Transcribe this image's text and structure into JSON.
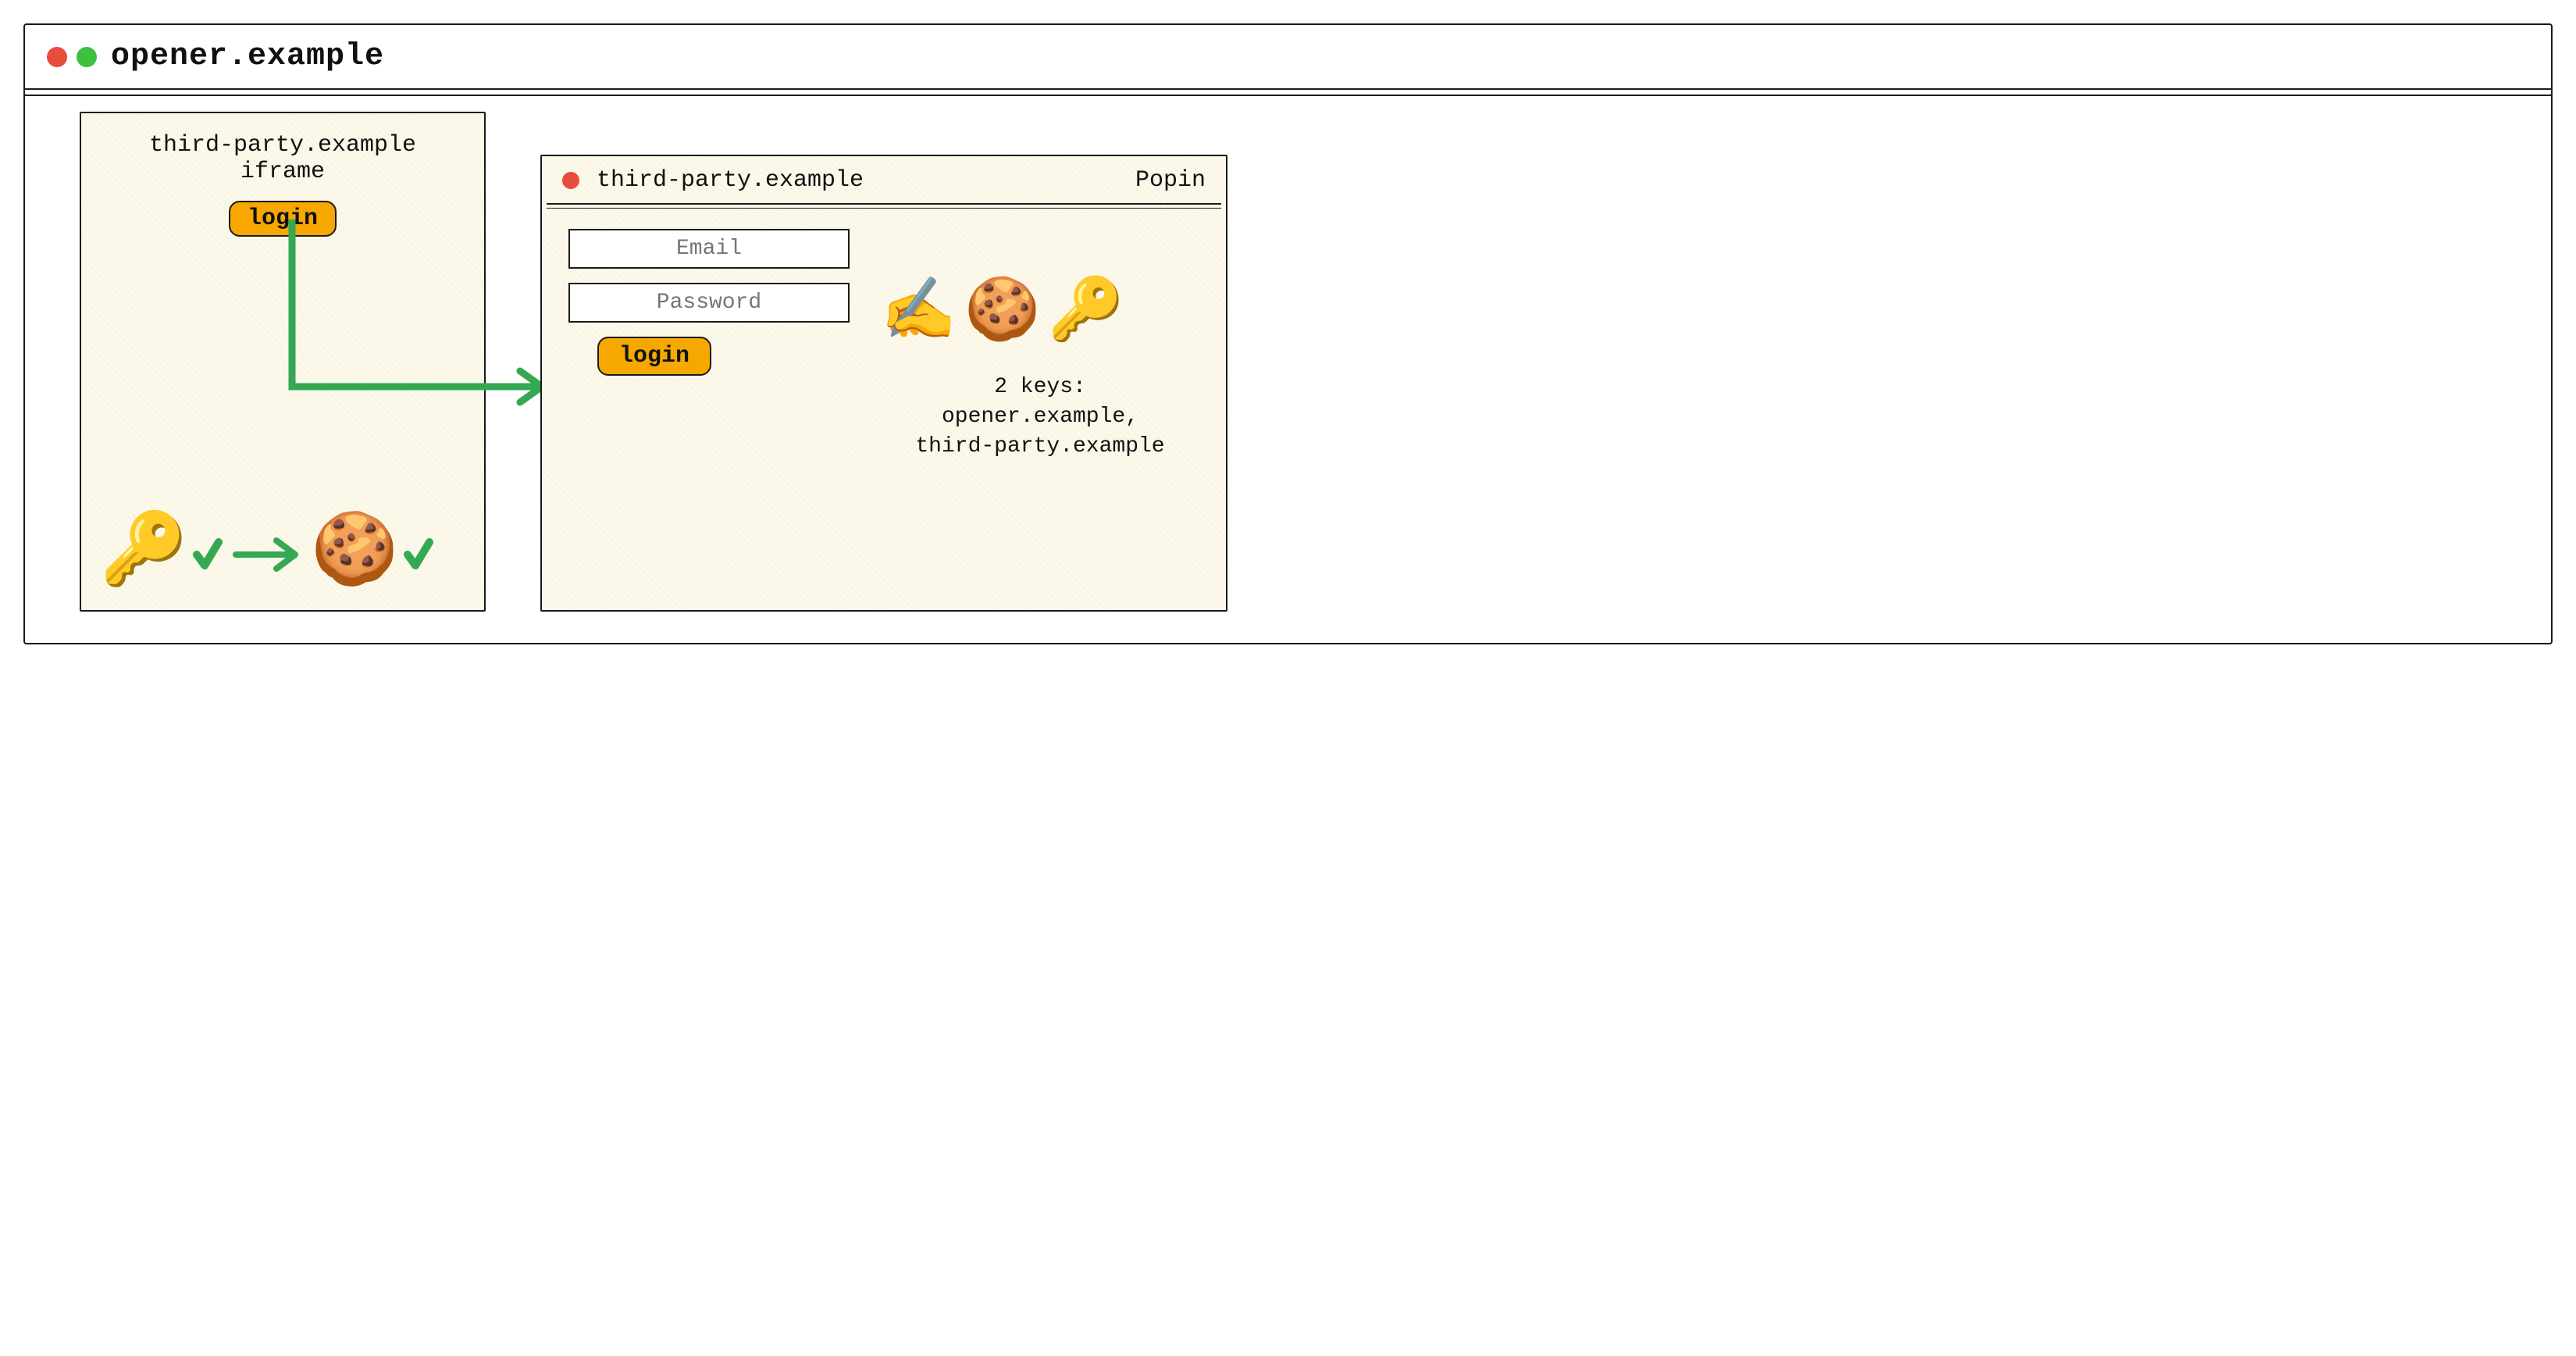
{
  "main_window": {
    "title": "opener.example"
  },
  "iframe_panel": {
    "label": "third-party.example iframe",
    "login_label": "login"
  },
  "popin_panel": {
    "title": "third-party.example",
    "tag": "Popin",
    "email_placeholder": "Email",
    "password_placeholder": "Password",
    "login_label": "login",
    "keys_heading": "2 keys:",
    "keys_line1": "opener.example,",
    "keys_line2": "third-party.example"
  },
  "icons": {
    "key": "🔑",
    "cookie": "🍪",
    "writing_hand": "✍️",
    "check": "✔"
  }
}
